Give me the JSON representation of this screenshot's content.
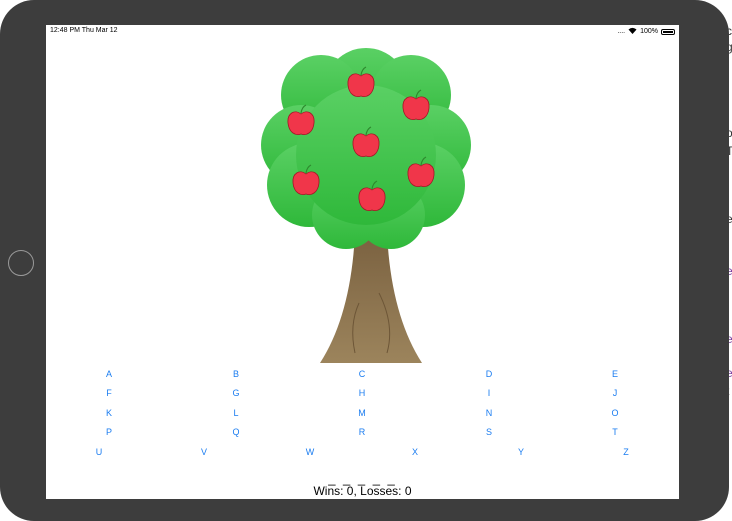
{
  "status_bar": {
    "time_date": "12:48 PM   Thu Mar 12",
    "signal": "....",
    "wifi_icon": "wifi-icon",
    "battery_percent": "100%",
    "battery_level": 1.0
  },
  "game": {
    "apples_on_tree": 7,
    "letter_rows": [
      [
        "A",
        "B",
        "C",
        "D",
        "E"
      ],
      [
        "F",
        "G",
        "H",
        "I",
        "J"
      ],
      [
        "K",
        "L",
        "M",
        "N",
        "O"
      ],
      [
        "P",
        "Q",
        "R",
        "S",
        "T"
      ],
      [
        "U",
        "V",
        "W",
        "X",
        "Y",
        "Z"
      ]
    ],
    "word_display": "_ _ _ _ _",
    "score_text": "Wins: 0, Losses: 0"
  },
  "background_window": {
    "fragments": [
      {
        "text": "c",
        "color": "#333333"
      },
      {
        "text": "g",
        "color": "#333333"
      },
      {
        "text": "o",
        "color": "#333333"
      },
      {
        "text": "T",
        "color": "#333333"
      },
      {
        "text": "i",
        "color": "#2a5fb0"
      },
      {
        "text": "e",
        "color": "#333333"
      },
      {
        "text": "e",
        "color": "#7a3fa0"
      },
      {
        "text": "i",
        "color": "#333333"
      },
      {
        "text": "e",
        "color": "#7a3fa0"
      },
      {
        "text": "e",
        "color": "#7a3fa0"
      },
      {
        "text": "t",
        "color": "#333333"
      }
    ]
  }
}
